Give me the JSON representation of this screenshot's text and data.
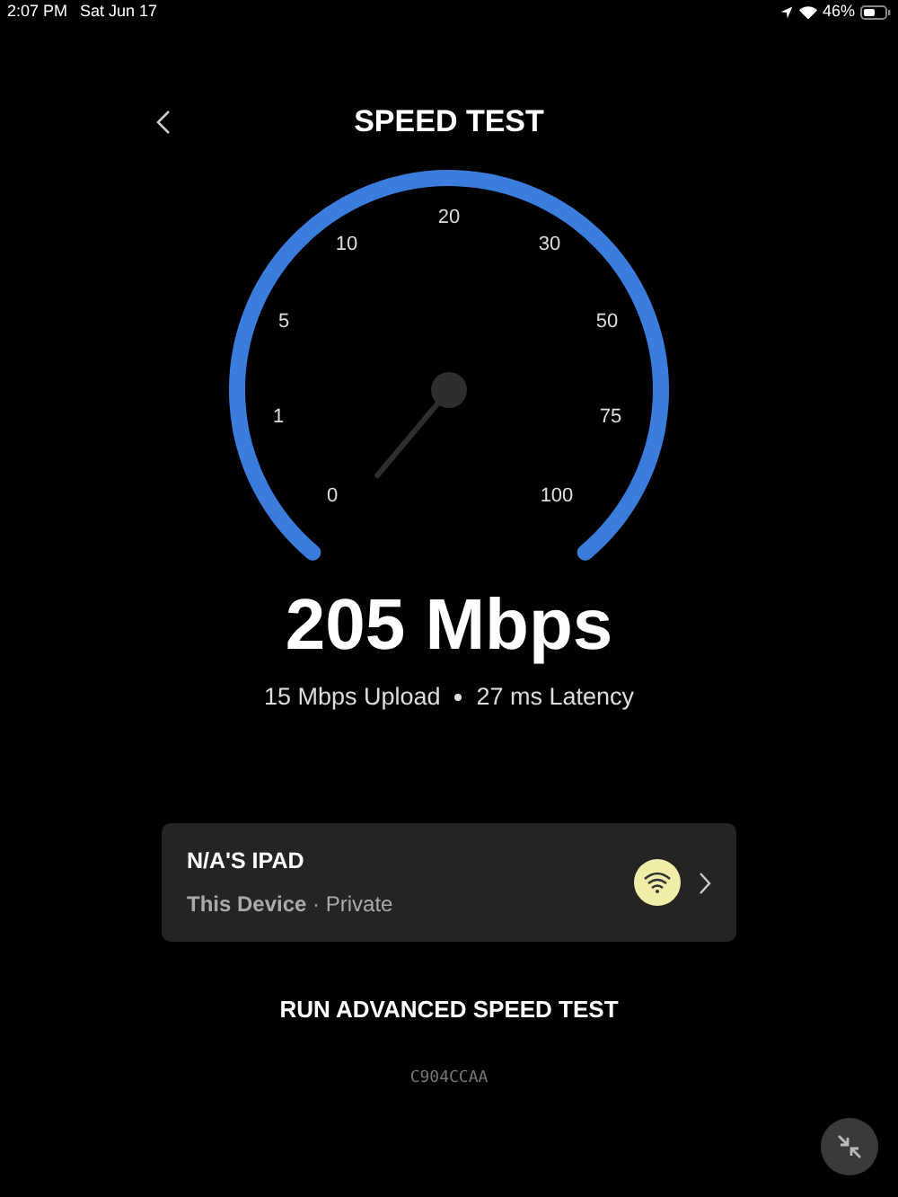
{
  "status_bar": {
    "time": "2:07 PM",
    "date": "Sat Jun 17",
    "battery": "46%"
  },
  "header": {
    "title": "SPEED TEST"
  },
  "gauge": {
    "ticks": [
      "0",
      "1",
      "5",
      "10",
      "20",
      "30",
      "50",
      "75",
      "100"
    ]
  },
  "result": {
    "speed": "205 Mbps",
    "upload": "15 Mbps Upload",
    "latency": "27 ms Latency"
  },
  "device": {
    "name": "N/A'S IPAD",
    "info": "**This Device** · Private"
  },
  "advanced_button": "RUN ADVANCED SPEED TEST",
  "code": "C904CCAA"
}
